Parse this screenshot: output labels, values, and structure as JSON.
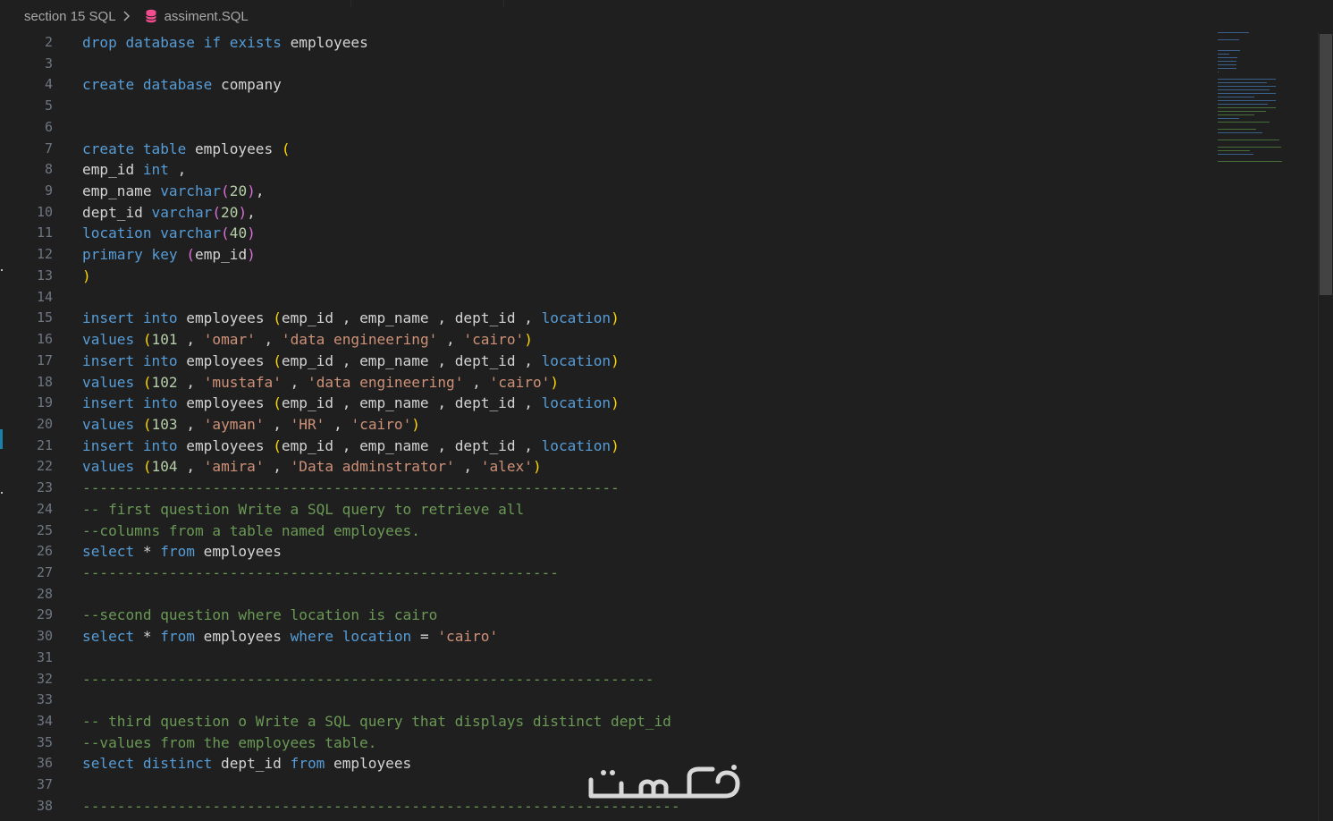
{
  "breadcrumb": {
    "folder": "section 15 SQL",
    "file": "assiment.SQL",
    "file_icon": "database-icon",
    "separator_icon": "chevron-right-icon"
  },
  "editor": {
    "language": "SQL",
    "lines": [
      {
        "n": "2",
        "tokens": [
          {
            "t": "kw",
            "v": "drop"
          },
          {
            "t": "",
            "v": " "
          },
          {
            "t": "kw",
            "v": "database"
          },
          {
            "t": "",
            "v": " "
          },
          {
            "t": "kw",
            "v": "if"
          },
          {
            "t": "",
            "v": " "
          },
          {
            "t": "kw",
            "v": "exists"
          },
          {
            "t": "",
            "v": " employees"
          }
        ]
      },
      {
        "n": "3",
        "tokens": []
      },
      {
        "n": "4",
        "tokens": [
          {
            "t": "kw",
            "v": "create"
          },
          {
            "t": "",
            "v": " "
          },
          {
            "t": "kw",
            "v": "database"
          },
          {
            "t": "",
            "v": " company"
          }
        ]
      },
      {
        "n": "5",
        "tokens": []
      },
      {
        "n": "6",
        "tokens": []
      },
      {
        "n": "7",
        "tokens": [
          {
            "t": "kw",
            "v": "create"
          },
          {
            "t": "",
            "v": " "
          },
          {
            "t": "kw",
            "v": "table"
          },
          {
            "t": "",
            "v": " employees "
          },
          {
            "t": "p1",
            "v": "("
          }
        ]
      },
      {
        "n": "8",
        "tokens": [
          {
            "t": "",
            "v": "emp_id "
          },
          {
            "t": "kw",
            "v": "int"
          },
          {
            "t": "",
            "v": " ,"
          }
        ]
      },
      {
        "n": "9",
        "tokens": [
          {
            "t": "",
            "v": "emp_name "
          },
          {
            "t": "kw",
            "v": "varchar"
          },
          {
            "t": "p2",
            "v": "("
          },
          {
            "t": "num",
            "v": "20"
          },
          {
            "t": "p2",
            "v": ")"
          },
          {
            "t": "",
            "v": ","
          }
        ]
      },
      {
        "n": "10",
        "tokens": [
          {
            "t": "",
            "v": "dept_id "
          },
          {
            "t": "kw",
            "v": "varchar"
          },
          {
            "t": "p2",
            "v": "("
          },
          {
            "t": "num",
            "v": "20"
          },
          {
            "t": "p2",
            "v": ")"
          },
          {
            "t": "",
            "v": ","
          }
        ]
      },
      {
        "n": "11",
        "tokens": [
          {
            "t": "kw",
            "v": "location"
          },
          {
            "t": "",
            "v": " "
          },
          {
            "t": "kw",
            "v": "varchar"
          },
          {
            "t": "p2",
            "v": "("
          },
          {
            "t": "num",
            "v": "40"
          },
          {
            "t": "p2",
            "v": ")"
          }
        ]
      },
      {
        "n": "12",
        "tokens": [
          {
            "t": "kw",
            "v": "primary"
          },
          {
            "t": "",
            "v": " "
          },
          {
            "t": "kw",
            "v": "key"
          },
          {
            "t": "",
            "v": " "
          },
          {
            "t": "p2",
            "v": "("
          },
          {
            "t": "",
            "v": "emp_id"
          },
          {
            "t": "p2",
            "v": ")"
          }
        ]
      },
      {
        "n": "13",
        "tokens": [
          {
            "t": "p1",
            "v": ")"
          }
        ]
      },
      {
        "n": "14",
        "tokens": []
      },
      {
        "n": "15",
        "tokens": [
          {
            "t": "kw",
            "v": "insert"
          },
          {
            "t": "",
            "v": " "
          },
          {
            "t": "kw",
            "v": "into"
          },
          {
            "t": "",
            "v": " employees "
          },
          {
            "t": "p1",
            "v": "("
          },
          {
            "t": "",
            "v": "emp_id , emp_name , dept_id , "
          },
          {
            "t": "kw",
            "v": "location"
          },
          {
            "t": "p1",
            "v": ")"
          }
        ]
      },
      {
        "n": "16",
        "tokens": [
          {
            "t": "kw",
            "v": "values"
          },
          {
            "t": "",
            "v": " "
          },
          {
            "t": "p1",
            "v": "("
          },
          {
            "t": "num",
            "v": "101"
          },
          {
            "t": "",
            "v": " , "
          },
          {
            "t": "str",
            "v": "'omar'"
          },
          {
            "t": "",
            "v": " , "
          },
          {
            "t": "str",
            "v": "'data engineering'"
          },
          {
            "t": "",
            "v": " , "
          },
          {
            "t": "str",
            "v": "'cairo'"
          },
          {
            "t": "p1",
            "v": ")"
          }
        ]
      },
      {
        "n": "17",
        "tokens": [
          {
            "t": "kw",
            "v": "insert"
          },
          {
            "t": "",
            "v": " "
          },
          {
            "t": "kw",
            "v": "into"
          },
          {
            "t": "",
            "v": " employees "
          },
          {
            "t": "p1",
            "v": "("
          },
          {
            "t": "",
            "v": "emp_id , emp_name , dept_id , "
          },
          {
            "t": "kw",
            "v": "location"
          },
          {
            "t": "p1",
            "v": ")"
          }
        ]
      },
      {
        "n": "18",
        "tokens": [
          {
            "t": "kw",
            "v": "values"
          },
          {
            "t": "",
            "v": " "
          },
          {
            "t": "p1",
            "v": "("
          },
          {
            "t": "num",
            "v": "102"
          },
          {
            "t": "",
            "v": " , "
          },
          {
            "t": "str",
            "v": "'mustafa'"
          },
          {
            "t": "",
            "v": " , "
          },
          {
            "t": "str",
            "v": "'data engineering'"
          },
          {
            "t": "",
            "v": " , "
          },
          {
            "t": "str",
            "v": "'cairo'"
          },
          {
            "t": "p1",
            "v": ")"
          }
        ]
      },
      {
        "n": "19",
        "tokens": [
          {
            "t": "kw",
            "v": "insert"
          },
          {
            "t": "",
            "v": " "
          },
          {
            "t": "kw",
            "v": "into"
          },
          {
            "t": "",
            "v": " employees "
          },
          {
            "t": "p1",
            "v": "("
          },
          {
            "t": "",
            "v": "emp_id , emp_name , dept_id , "
          },
          {
            "t": "kw",
            "v": "location"
          },
          {
            "t": "p1",
            "v": ")"
          }
        ]
      },
      {
        "n": "20",
        "tokens": [
          {
            "t": "kw",
            "v": "values"
          },
          {
            "t": "",
            "v": " "
          },
          {
            "t": "p1",
            "v": "("
          },
          {
            "t": "num",
            "v": "103"
          },
          {
            "t": "",
            "v": " , "
          },
          {
            "t": "str",
            "v": "'ayman'"
          },
          {
            "t": "",
            "v": " , "
          },
          {
            "t": "str",
            "v": "'HR'"
          },
          {
            "t": "",
            "v": " , "
          },
          {
            "t": "str",
            "v": "'cairo'"
          },
          {
            "t": "p1",
            "v": ")"
          }
        ]
      },
      {
        "n": "21",
        "tokens": [
          {
            "t": "kw",
            "v": "insert"
          },
          {
            "t": "",
            "v": " "
          },
          {
            "t": "kw",
            "v": "into"
          },
          {
            "t": "",
            "v": " employees "
          },
          {
            "t": "p1",
            "v": "("
          },
          {
            "t": "",
            "v": "emp_id , emp_name , dept_id , "
          },
          {
            "t": "kw",
            "v": "location"
          },
          {
            "t": "p1",
            "v": ")"
          }
        ]
      },
      {
        "n": "22",
        "tokens": [
          {
            "t": "kw",
            "v": "values"
          },
          {
            "t": "",
            "v": " "
          },
          {
            "t": "p1",
            "v": "("
          },
          {
            "t": "num",
            "v": "104"
          },
          {
            "t": "",
            "v": " , "
          },
          {
            "t": "str",
            "v": "'amira'"
          },
          {
            "t": "",
            "v": " , "
          },
          {
            "t": "str",
            "v": "'Data adminstrator'"
          },
          {
            "t": "",
            "v": " , "
          },
          {
            "t": "str",
            "v": "'alex'"
          },
          {
            "t": "p1",
            "v": ")"
          }
        ]
      },
      {
        "n": "23",
        "tokens": [
          {
            "t": "cmt",
            "v": "--------------------------------------------------------------"
          }
        ]
      },
      {
        "n": "24",
        "tokens": [
          {
            "t": "cmt",
            "v": "-- first question Write a SQL query to retrieve all"
          }
        ]
      },
      {
        "n": "25",
        "tokens": [
          {
            "t": "cmt",
            "v": "--columns from a table named employees."
          }
        ]
      },
      {
        "n": "26",
        "tokens": [
          {
            "t": "kw",
            "v": "select"
          },
          {
            "t": "",
            "v": " * "
          },
          {
            "t": "kw",
            "v": "from"
          },
          {
            "t": "",
            "v": " employees"
          }
        ]
      },
      {
        "n": "27",
        "tokens": [
          {
            "t": "cmt",
            "v": "-------------------------------------------------------"
          }
        ]
      },
      {
        "n": "28",
        "tokens": []
      },
      {
        "n": "29",
        "tokens": [
          {
            "t": "cmt",
            "v": "--second question where location is cairo"
          }
        ]
      },
      {
        "n": "30",
        "tokens": [
          {
            "t": "kw",
            "v": "select"
          },
          {
            "t": "",
            "v": " * "
          },
          {
            "t": "kw",
            "v": "from"
          },
          {
            "t": "",
            "v": " employees "
          },
          {
            "t": "kw",
            "v": "where"
          },
          {
            "t": "",
            "v": " "
          },
          {
            "t": "kw",
            "v": "location"
          },
          {
            "t": "",
            "v": " = "
          },
          {
            "t": "str",
            "v": "'cairo'"
          }
        ]
      },
      {
        "n": "31",
        "tokens": []
      },
      {
        "n": "32",
        "tokens": [
          {
            "t": "cmt",
            "v": "------------------------------------------------------------------"
          }
        ]
      },
      {
        "n": "33",
        "tokens": []
      },
      {
        "n": "34",
        "tokens": [
          {
            "t": "cmt",
            "v": "-- third question o Write a SQL query that displays distinct dept_id"
          }
        ]
      },
      {
        "n": "35",
        "tokens": [
          {
            "t": "cmt",
            "v": "--values from the employees table."
          }
        ]
      },
      {
        "n": "36",
        "tokens": [
          {
            "t": "kw",
            "v": "select"
          },
          {
            "t": "",
            "v": " "
          },
          {
            "t": "kw",
            "v": "distinct"
          },
          {
            "t": "",
            "v": " dept_id "
          },
          {
            "t": "kw",
            "v": "from"
          },
          {
            "t": "",
            "v": " employees"
          }
        ]
      },
      {
        "n": "37",
        "tokens": []
      },
      {
        "n": "38",
        "tokens": [
          {
            "t": "cmt",
            "v": "---------------------------------------------------------------------"
          }
        ]
      }
    ]
  },
  "watermark": {
    "text": "خمسات",
    "icon": "khamsat-logo"
  },
  "colors": {
    "background": "#1f1f1f",
    "keyword": "#569cd6",
    "string": "#ce9178",
    "number": "#b5cea8",
    "comment": "#6a9955",
    "bracket_level1": "#ffd700",
    "bracket_level2": "#da70d6",
    "line_number": "#6e7681",
    "text": "#d4d4d4"
  }
}
